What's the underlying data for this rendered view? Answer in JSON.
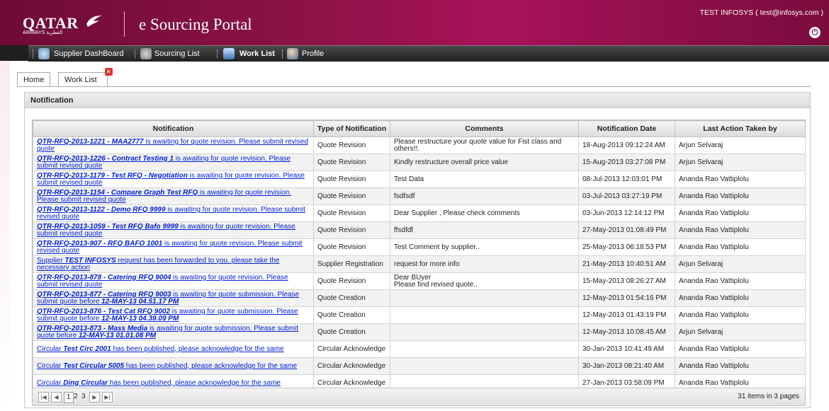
{
  "header": {
    "logo_text": "QATAR",
    "logo_sub": "AIRWAYS القطرية",
    "portal_title": "e Sourcing Portal",
    "user_info": "TEST INFOSYS ( test@infosys.com )"
  },
  "nav": {
    "items": [
      {
        "label": "Supplier DashBoard",
        "icon": "dashboard-icon"
      },
      {
        "label": "Sourcing List",
        "icon": "sourcing-list-icon"
      },
      {
        "label": "Work List",
        "icon": "work-list-icon"
      },
      {
        "label": "Profile",
        "icon": "profile-icon"
      }
    ]
  },
  "tabs": {
    "home": "Home",
    "worklist": "Work List"
  },
  "panel": {
    "title": "Notification"
  },
  "table": {
    "headers": [
      "Notification",
      "Type of Notification",
      "Comments",
      "Notification Date",
      "Last Action Taken by"
    ],
    "rows": [
      {
        "notif_pre": "",
        "notif_bold": "QTR-RFQ-2013-1221 - MAA2777",
        "notif_post": " is awaiting for quote revision. Please submit revised quote",
        "type": "Quote Revision",
        "comments": "Please restructure your quote value for Fist class and others!!.",
        "date": "18-Aug-2013 09:12:24 AM",
        "by": "Arjun Selvaraj"
      },
      {
        "notif_pre": "",
        "notif_bold": "QTR-RFQ-2013-1226 - Contract Testing 1",
        "notif_post": " is awaiting for quote revision. Please submit revised quote",
        "type": "Quote Revision",
        "comments": "Kindly restructure overall price value",
        "date": "15-Aug-2013 03:27:08 PM",
        "by": "Arjun Selvaraj"
      },
      {
        "notif_pre": "",
        "notif_bold": "QTR-RFQ-2013-1179 - Test RFQ - Negotiation",
        "notif_post": " is awaiting for quote revision. Please submit revised quote",
        "type": "Quote Revision",
        "comments": "Test Data",
        "date": "08-Jul-2013 12:03:01 PM",
        "by": "Ananda Rao Vattiplolu"
      },
      {
        "notif_pre": "",
        "notif_bold": "QTR-RFQ-2013-1154 - Compare Graph Test RFQ",
        "notif_post": " is awaiting for quote revision. Please submit revised quote",
        "type": "Quote Revision",
        "comments": "fsdfsdf",
        "date": "03-Jul-2013 03:27:19 PM",
        "by": "Ananda Rao Vattiplolu"
      },
      {
        "notif_pre": "",
        "notif_bold": "QTR-RFQ-2013-1122 - Demo RFQ 9999",
        "notif_post": " is awaiting for quote revision. Please submit revised quote",
        "type": "Quote Revision",
        "comments": "Dear Supplier , Please check comments",
        "date": "03-Jun-2013 12:14:12 PM",
        "by": "Ananda Rao Vattiplolu"
      },
      {
        "notif_pre": "",
        "notif_bold": "QTR-RFQ-2013-1059 - Test RFQ Bafo 9999",
        "notif_post": " is awaiting for quote revision. Please submit revised quote",
        "type": "Quote Revision",
        "comments": "ffsdfdf",
        "date": "27-May-2013 01:08:49 PM",
        "by": "Ananda Rao Vattiplolu"
      },
      {
        "notif_pre": "",
        "notif_bold": "QTR-RFQ-2013-907 - RFQ BAFO 1001",
        "notif_post": " is awaiting for quote revision. Please submit revised quote",
        "type": "Quote Revision",
        "comments": "Test Comment by supplier..",
        "date": "25-May-2013 06:18:53 PM",
        "by": "Ananda Rao Vattiplolu"
      },
      {
        "notif_pre": "Supplier ",
        "notif_bold": "TEST INFOSYS",
        "notif_post": " request has been forwarded to you. please take the necessary action",
        "type": "Supplier Registration",
        "comments": "request for more info",
        "date": "21-May-2013 10:40:51 AM",
        "by": "Arjun Selvaraj"
      },
      {
        "notif_pre": "",
        "notif_bold": "QTR-RFQ-2013-878 - Catering RFQ 9004",
        "notif_post": " is awaiting for quote revision. Please submit revised quote",
        "type": "Quote Revision",
        "comments": "Dear BUyer\nPlease find revised quote..",
        "date": "15-May-2013 08:26:27 AM",
        "by": "Ananda Rao Vattiplolu"
      },
      {
        "notif_pre": "",
        "notif_bold": "QTR-RFQ-2013-877 - Catering RFQ 9003",
        "notif_post": " is awaiting for quote submission. Please submit quote before ",
        "notif_bold2": "12-MAY-13 04.51.17 PM",
        "type": "Quote Creation",
        "comments": "",
        "date": "12-May-2013 01:54:16 PM",
        "by": "Ananda Rao Vattiplolu"
      },
      {
        "notif_pre": "",
        "notif_bold": "QTR-RFQ-2013-876 - Test Cat RFQ 9002",
        "notif_post": " is awaiting for quote submission. Please submit quote before ",
        "notif_bold2": "12-MAY-13 04.39.09 PM",
        "type": "Quote Creation",
        "comments": "",
        "date": "12-May-2013 01:43:19 PM",
        "by": "Ananda Rao Vattiplolu"
      },
      {
        "notif_pre": "",
        "notif_bold": "QTR-RFQ-2013-873 - Mass Media",
        "notif_post": " is awaiting for quote submission. Please submit quote before ",
        "notif_bold2": "12-MAY-13 01.01.08 PM",
        "type": "Quote Creation",
        "comments": "",
        "date": "12-May-2013 10:08:45 AM",
        "by": "Arjun Selvaraj"
      },
      {
        "notif_pre": "Circular ",
        "notif_bold": "Test Circ 2001",
        "notif_post": " has been published, please acknowledge for the same",
        "type": "Circular Acknowledge",
        "comments": "",
        "date": "30-Jan-2013 10:41:49 AM",
        "by": "Ananda Rao Vattiplolu"
      },
      {
        "notif_pre": "Circular ",
        "notif_bold": "Test Circular 5005",
        "notif_post": " has been published, please acknowledge for the same",
        "type": "Circular Acknowledge",
        "comments": "",
        "date": "30-Jan-2013 08:21:40 AM",
        "by": "Ananda Rao Vattiplolu"
      },
      {
        "notif_pre": "Circular ",
        "notif_bold": "Ding Circular",
        "notif_post": " has been published, please acknowledge for the same",
        "type": "Circular Acknowledge",
        "comments": "",
        "date": "27-Jan-2013 03:58:09 PM",
        "by": "Ananda Rao Vattiplolu"
      }
    ]
  },
  "pager": {
    "pages": [
      "1",
      "2",
      "3"
    ],
    "current": "1",
    "info": "31 items in 3 pages"
  },
  "colors": {
    "brand": "#8b1245",
    "link": "#0020d6",
    "nav_bg": "#2a2a2a"
  }
}
